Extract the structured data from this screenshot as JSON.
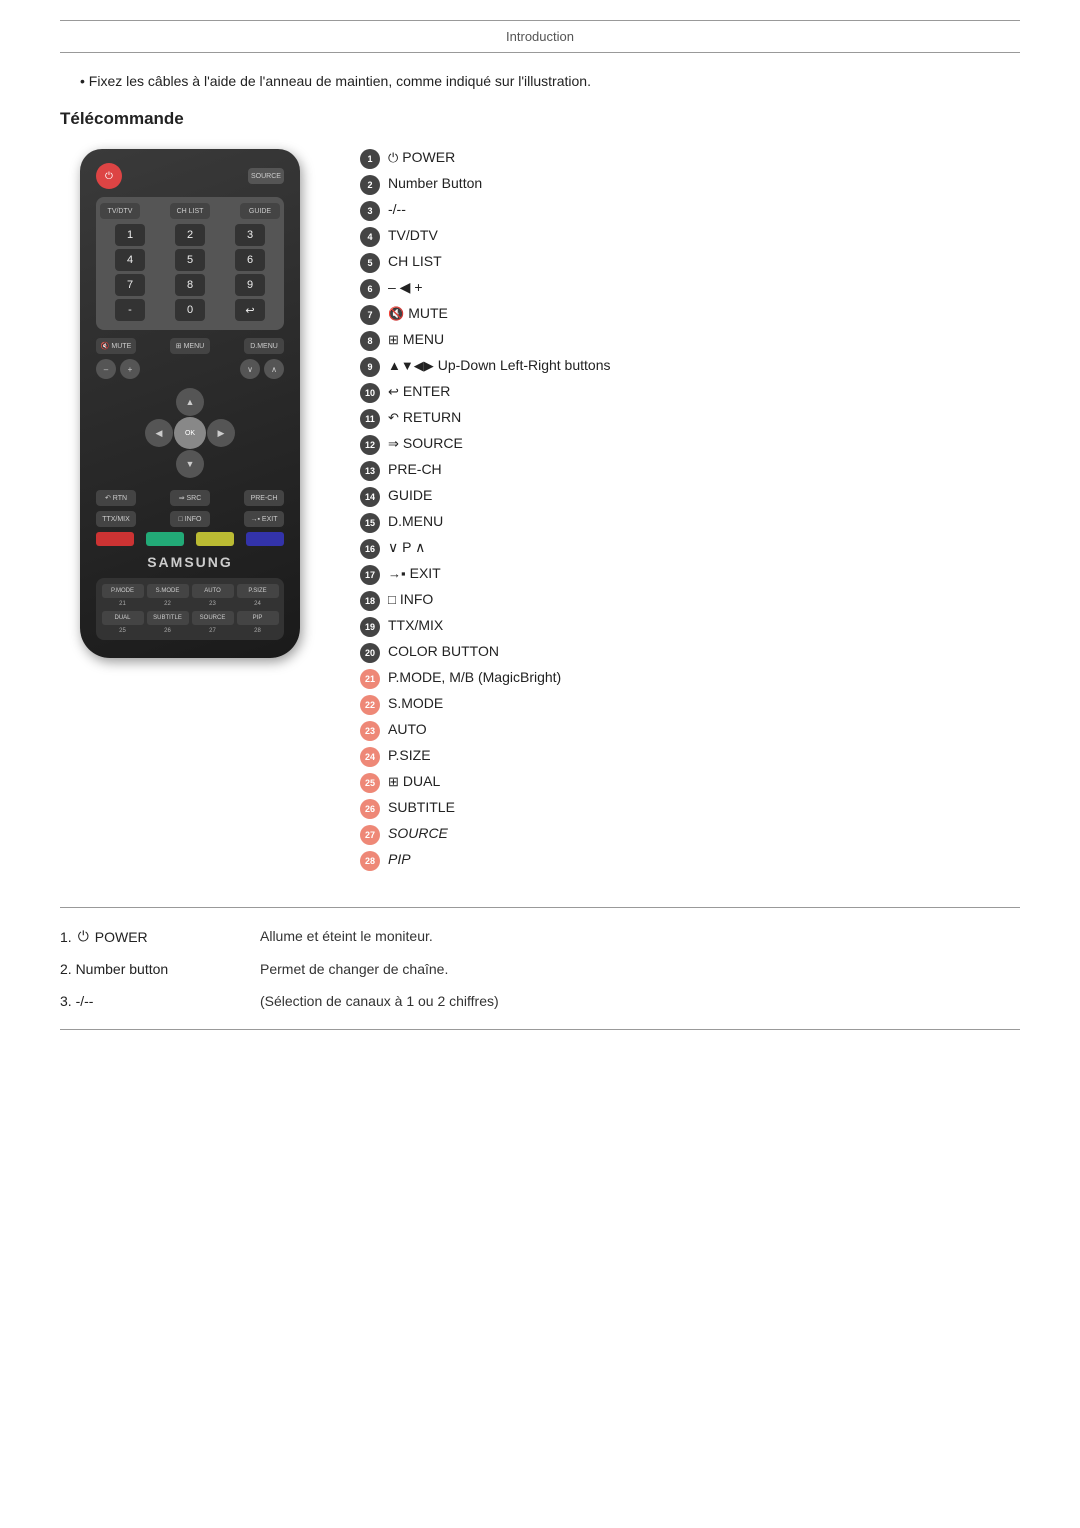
{
  "header": {
    "title": "Introduction"
  },
  "bullet": {
    "text": "Fixez les câbles à l'aide de l'anneau de maintien, comme indiqué sur l'illustration."
  },
  "section": {
    "title": "Télécommande"
  },
  "remote": {
    "samsung_label": "SAMSUNG",
    "numpad": {
      "row1": [
        "1",
        "2",
        "3"
      ],
      "row2": [
        "4",
        "5",
        "6"
      ],
      "row3": [
        "7",
        "8",
        "9"
      ],
      "row4": [
        "0"
      ]
    },
    "bottom_labels_row1": [
      "P.MODE",
      "S.MODE",
      "AUTO",
      "P.SIZE"
    ],
    "bottom_labels_row2": [
      "DUAL",
      "SUBTITLE",
      "SOURCE",
      "PIP"
    ],
    "bottom_nums_row1": [
      "21",
      "22",
      "23",
      "24"
    ],
    "bottom_nums_row2": [
      "25",
      "26",
      "27",
      "28"
    ]
  },
  "features": [
    {
      "num": "1",
      "icon": "⏻",
      "text": "POWER"
    },
    {
      "num": "2",
      "icon": "",
      "text": "Number Button"
    },
    {
      "num": "3",
      "icon": "",
      "text": "-/--"
    },
    {
      "num": "4",
      "icon": "",
      "text": "TV/DTV"
    },
    {
      "num": "5",
      "icon": "",
      "text": "CH LIST"
    },
    {
      "num": "6",
      "icon": "– ◀ +",
      "text": ""
    },
    {
      "num": "7",
      "icon": "🔇",
      "text": "MUTE"
    },
    {
      "num": "8",
      "icon": "⊞",
      "text": "MENU"
    },
    {
      "num": "9",
      "icon": "▲▼◀▶",
      "text": "Up-Down Left-Right buttons"
    },
    {
      "num": "10",
      "icon": "↩",
      "text": "ENTER"
    },
    {
      "num": "11",
      "icon": "↶",
      "text": "RETURN"
    },
    {
      "num": "12",
      "icon": "⇒",
      "text": "SOURCE"
    },
    {
      "num": "13",
      "icon": "",
      "text": "PRE-CH"
    },
    {
      "num": "14",
      "icon": "",
      "text": "GUIDE"
    },
    {
      "num": "15",
      "icon": "",
      "text": "D.MENU"
    },
    {
      "num": "16",
      "icon": "",
      "text": "∨ P ∧"
    },
    {
      "num": "17",
      "icon": "→▪",
      "text": "EXIT"
    },
    {
      "num": "18",
      "icon": "□",
      "text": "INFO"
    },
    {
      "num": "19",
      "icon": "",
      "text": "TTX/MIX"
    },
    {
      "num": "20",
      "icon": "",
      "text": "COLOR BUTTON"
    },
    {
      "num": "21",
      "icon": "",
      "text": "P.MODE, M/B (MagicBright)"
    },
    {
      "num": "22",
      "icon": "",
      "text": "S.MODE"
    },
    {
      "num": "23",
      "icon": "",
      "text": "AUTO"
    },
    {
      "num": "24",
      "icon": "",
      "text": "P.SIZE"
    },
    {
      "num": "25",
      "icon": "⊞",
      "text": "DUAL"
    },
    {
      "num": "26",
      "icon": "",
      "text": "SUBTITLE"
    },
    {
      "num": "27",
      "icon": "",
      "text": "SOURCE",
      "italic": true
    },
    {
      "num": "28",
      "icon": "",
      "text": "PIP",
      "italic": true
    }
  ],
  "descriptions": [
    {
      "num": "1",
      "icon": "⏻",
      "label": "POWER",
      "value": "Allume et éteint le moniteur."
    },
    {
      "num": "2",
      "label": "Number button",
      "value": "Permet de changer de chaîne."
    },
    {
      "num": "3",
      "label": "-/--",
      "value": "(Sélection de canaux à 1 ou 2 chiffres)"
    }
  ]
}
